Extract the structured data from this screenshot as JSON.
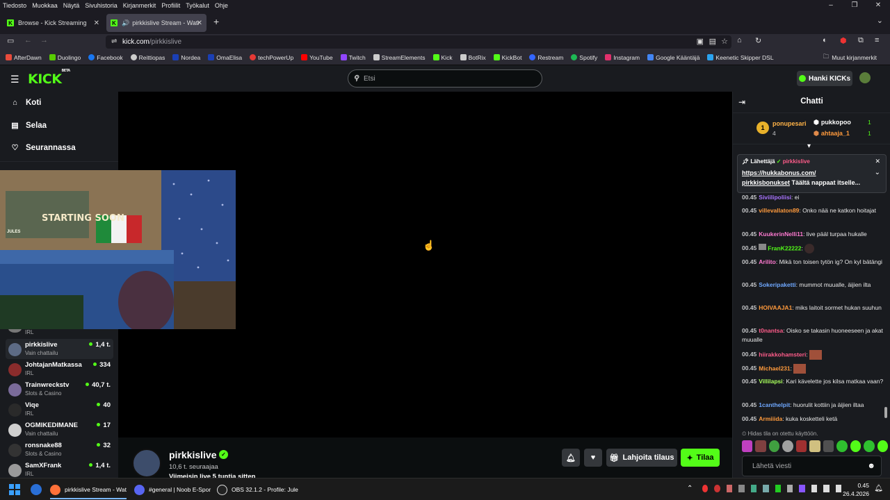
{
  "browser": {
    "menu": [
      "Tiedosto",
      "Muokkaa",
      "Näytä",
      "Sivuhistoria",
      "Kirjanmerkit",
      "Profiilit",
      "Työkalut",
      "Ohje"
    ],
    "tabs": [
      {
        "label": "Browse - Kick Streaming",
        "active": false
      },
      {
        "label": "pirkkislive Stream - Watch L",
        "active": true
      }
    ],
    "url_host": "kick.com",
    "url_path": "/pirkkislive",
    "bookmarks": [
      {
        "label": "AfterDawn",
        "color": "#e94b3c"
      },
      {
        "label": "Duolingo",
        "color": "#58cc02"
      },
      {
        "label": "Facebook",
        "color": "#1877f2"
      },
      {
        "label": "Reittiopas",
        "color": "#cccccc"
      },
      {
        "label": "Nordea",
        "color": "#1a3fb5"
      },
      {
        "label": "OmaElisa",
        "color": "#1a3fb5"
      },
      {
        "label": "techPowerUp",
        "color": "#e53935"
      },
      {
        "label": "YouTube",
        "color": "#ff0000"
      },
      {
        "label": "Twitch",
        "color": "#9146ff"
      },
      {
        "label": "StreamElements",
        "color": "#cccccc"
      },
      {
        "label": "Kick",
        "color": "#53fc18"
      },
      {
        "label": "BotRix",
        "color": "#cccccc"
      },
      {
        "label": "KickBot",
        "color": "#53fc18"
      },
      {
        "label": "Restream",
        "color": "#3366ff"
      },
      {
        "label": "Spotify",
        "color": "#1db954"
      },
      {
        "label": "Instagram",
        "color": "#e1306c"
      },
      {
        "label": "Google Kääntäjä",
        "color": "#4285f4"
      },
      {
        "label": "Keenetic Skipper DSL",
        "color": "#2aa3ef"
      }
    ],
    "other_bookmarks": "Muut kirjanmerkit"
  },
  "kick": {
    "logo": "KICK",
    "logo_tag": "BETA",
    "search_placeholder": "Etsi",
    "get_kicks": "Hanki KICKs",
    "nav": [
      {
        "label": "Koti",
        "icon": "home-icon"
      },
      {
        "label": "Selaa",
        "icon": "browse-icon"
      },
      {
        "label": "Seurannassa",
        "icon": "heart-icon"
      }
    ],
    "channels": [
      {
        "name": "",
        "category": "IRL",
        "viewers": ""
      },
      {
        "name": "pirkkislive",
        "category": "Vain chattailu",
        "viewers": "1,4 t."
      },
      {
        "name": "JohtajanMatkassa",
        "category": "IRL",
        "viewers": "334"
      },
      {
        "name": "Trainwreckstv",
        "category": "Slots & Casino",
        "viewers": "40,7 t."
      },
      {
        "name": "Viqe",
        "category": "IRL",
        "viewers": "40"
      },
      {
        "name": "OGMIKEDIMANE",
        "category": "Vain chattailu",
        "viewers": "17"
      },
      {
        "name": "ronsnake88",
        "category": "Slots & Casino",
        "viewers": "32"
      },
      {
        "name": "SamXFrank",
        "category": "IRL",
        "viewers": "1,4 t."
      }
    ],
    "webcam_overlay": {
      "badge_name": "JULES",
      "text": "STARTING SOON"
    },
    "channel": {
      "name": "pirkkislive",
      "followers": "10,6 t. seuraajaa",
      "last_live": "Viimeisin live 5 tuntia sitten",
      "gift_sub": "Lahjoita tilaus",
      "subscribe": "Tilaa"
    },
    "chat": {
      "title": "Chatti",
      "leaderboard": [
        {
          "rank": "1",
          "name": "ponupesari",
          "count": "4"
        },
        {
          "rank": "",
          "name": "pukkopoo",
          "count": "1"
        },
        {
          "rank": "",
          "name": "ahtaaja_1",
          "count": "1"
        }
      ],
      "pinned": {
        "label": "Lähettäjä",
        "author": "pirkkislive",
        "link": "https://hukkabonus.com/",
        "link2": "pirkkisbonukset",
        "text": "Täältä nappaat itselle..."
      },
      "messages": [
        {
          "time": "00.45",
          "user": "Siviilipoliisi",
          "color": "#a974ff",
          "text": "ei"
        },
        {
          "time": "00.45",
          "user": "villevallaton89",
          "color": "#ff9a3c",
          "text": "Onko nää ne katkon hoitajat"
        },
        {
          "time": "00.45",
          "user": "KuukerinNelli11",
          "color": "#ff7ad1",
          "text": "live pääl turpaa hukalle"
        },
        {
          "time": "00.45",
          "user": "FranK22222",
          "color": "#53fc18",
          "text": ""
        },
        {
          "time": "00.45",
          "user": "Arilito",
          "color": "#ff7ad1",
          "text": "Mikä ton toisen tytön ig? On kyl bätängi"
        },
        {
          "time": "00.45",
          "user": "Sokeripaketti",
          "color": "#6fa8ff",
          "text": "mummot muualle, äijien ilta"
        },
        {
          "time": "00.45",
          "user": "HOIVAAJA1",
          "color": "#ff9a3c",
          "text": "miks laitoit sormet hukan suuhun"
        },
        {
          "time": "00.45",
          "user": "t0nantsa",
          "color": "#ff5c8a",
          "text": "Oisko se takasin huoneeseen ja akat muualle"
        },
        {
          "time": "00.45",
          "user": "hiirakkohamsteri",
          "color": "#ff5c8a",
          "text": ""
        },
        {
          "time": "00.45",
          "user": "Michael231",
          "color": "#ff9a3c",
          "text": ""
        },
        {
          "time": "00.45",
          "user": "Villilapsi",
          "color": "#a8ff5c",
          "text": "Kari kävelette jos kilsa matkaa vaan?"
        },
        {
          "time": "00.45",
          "user": "1canthelpit",
          "color": "#6fa8ff",
          "text": "huorulit kottiin ja äijien iltaa"
        },
        {
          "time": "00.45",
          "user": "Armiiida",
          "color": "#ff9a3c",
          "text": "kuka kosketteli ketä"
        }
      ],
      "slow_mode": "Hidas tila on otettu käyttöön.",
      "input_placeholder": "Lähetä viesti"
    }
  },
  "taskbar": {
    "items": [
      {
        "label": "pirkkislive Stream - Wat",
        "color": "#ff7139"
      },
      {
        "label": "#general | Noob E-Spor",
        "color": "#5865f2"
      },
      {
        "label": "OBS 32.1.2 - Profile: Jule",
        "color": "#dddddd"
      }
    ],
    "time": "0.45",
    "date": "26.4.2026"
  }
}
